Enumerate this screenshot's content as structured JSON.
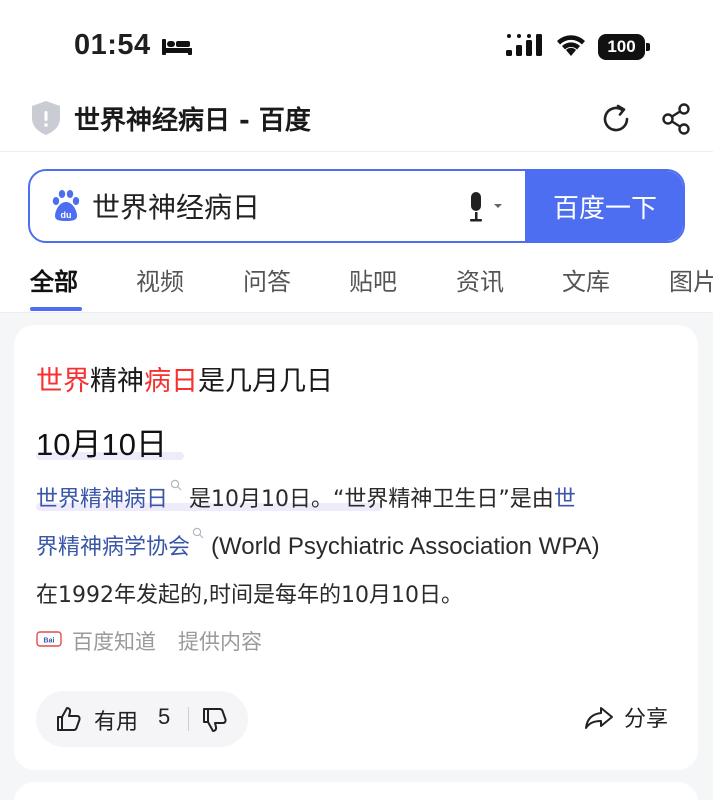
{
  "status_bar": {
    "time": "01:54",
    "battery_level": "100",
    "icons": [
      "bed-icon",
      "signal-icon",
      "wifi-icon",
      "battery-icon"
    ]
  },
  "title_bar": {
    "title": "世界神经病日 - 百度",
    "icons": [
      "shield-icon",
      "refresh-icon",
      "share-icon"
    ]
  },
  "search": {
    "query": "世界神经病日",
    "button_label": "百度一下",
    "accent_color": "#4e6ef2"
  },
  "tabs": [
    {
      "label": "全部",
      "active": true
    },
    {
      "label": "视频",
      "active": false
    },
    {
      "label": "问答",
      "active": false
    },
    {
      "label": "贴吧",
      "active": false
    },
    {
      "label": "资讯",
      "active": false
    },
    {
      "label": "文库",
      "active": false
    },
    {
      "label": "图片",
      "active": false
    }
  ],
  "answer_card": {
    "question": {
      "part1": "世界",
      "part2": "精神",
      "part3": "病日",
      "part4": "是几月几日"
    },
    "highlight_color": "#f73131",
    "answer": "10月10日",
    "body": {
      "link1": "世界精神病日",
      "text1": "是10月10日。“世界精神卫生日”是由",
      "link2a": "世",
      "link2b": "界精神病学协会",
      "text2": "(World Psychiatric Association WPA)",
      "text3": "在1992年发起的,时间是每年的10月10日。"
    },
    "source_name": "百度知道",
    "source_note": "提供内容",
    "useful_label": "有用",
    "useful_count": "5",
    "share_label": "分享"
  }
}
